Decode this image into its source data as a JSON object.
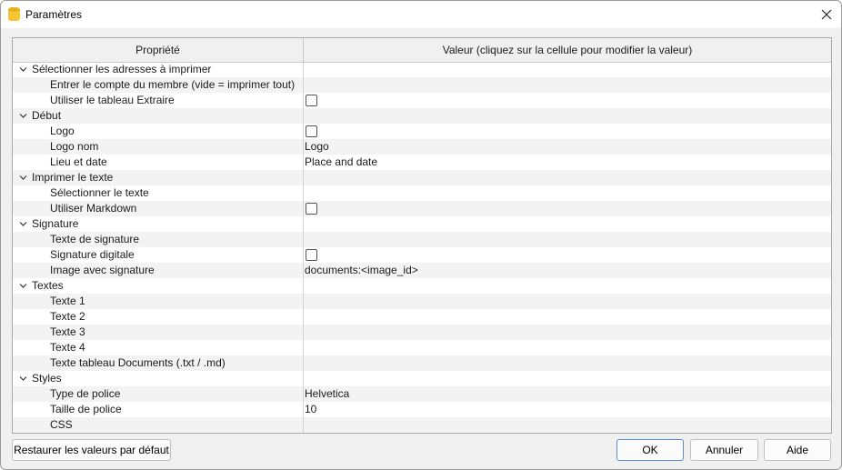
{
  "window": {
    "title": "Paramètres"
  },
  "table": {
    "header_property": "Propriété",
    "header_value": "Valeur (cliquez sur la cellule pour modifier la valeur)",
    "rows": [
      {
        "kind": "group",
        "label": "Sélectionner les adresses à imprimer",
        "value": ""
      },
      {
        "kind": "child",
        "label": "Entrer le compte du membre (vide = imprimer tout)",
        "value": ""
      },
      {
        "kind": "child",
        "label": "Utiliser le tableau Extraire",
        "checkbox": true,
        "checked": false
      },
      {
        "kind": "group",
        "label": "Début",
        "value": ""
      },
      {
        "kind": "child",
        "label": "Logo",
        "checkbox": true,
        "checked": false
      },
      {
        "kind": "child",
        "label": "Logo nom",
        "value": "Logo"
      },
      {
        "kind": "child",
        "label": "Lieu et date",
        "value": "Place and date"
      },
      {
        "kind": "group",
        "label": "Imprimer le texte",
        "value": ""
      },
      {
        "kind": "child",
        "label": "Sélectionner le texte",
        "value": ""
      },
      {
        "kind": "child",
        "label": "Utiliser Markdown",
        "checkbox": true,
        "checked": false
      },
      {
        "kind": "group",
        "label": "Signature",
        "value": ""
      },
      {
        "kind": "child",
        "label": "Texte de signature",
        "value": ""
      },
      {
        "kind": "child",
        "label": "Signature digitale",
        "checkbox": true,
        "checked": false
      },
      {
        "kind": "child",
        "label": "Image avec signature",
        "value": "documents:<image_id>"
      },
      {
        "kind": "group",
        "label": "Textes",
        "value": ""
      },
      {
        "kind": "child",
        "label": "Texte 1",
        "value": ""
      },
      {
        "kind": "child",
        "label": "Texte 2",
        "value": ""
      },
      {
        "kind": "child",
        "label": "Texte 3",
        "value": ""
      },
      {
        "kind": "child",
        "label": "Texte 4",
        "value": ""
      },
      {
        "kind": "child",
        "label": "Texte tableau Documents (.txt / .md)",
        "value": ""
      },
      {
        "kind": "group",
        "label": "Styles",
        "value": ""
      },
      {
        "kind": "child",
        "label": "Type de police",
        "value": "Helvetica"
      },
      {
        "kind": "child",
        "label": "Taille de police",
        "value": "10"
      },
      {
        "kind": "child",
        "label": "CSS",
        "value": ""
      }
    ]
  },
  "buttons": {
    "restore": "Restaurer les valeurs par défaut",
    "ok": "OK",
    "cancel": "Annuler",
    "help": "Aide"
  },
  "icons": {
    "app": "database-icon",
    "close": "close-icon",
    "expand": "chevron-down-icon"
  },
  "colors": {
    "app_icon": "#f5c533",
    "ok_border": "#5a8fd8",
    "alt_row": "#f3f3f3"
  }
}
